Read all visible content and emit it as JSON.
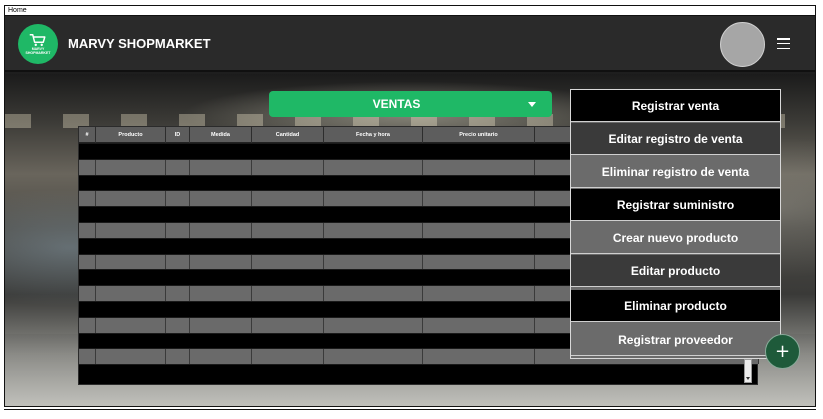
{
  "window": {
    "tab_label": "Home"
  },
  "header": {
    "logo": {
      "icon": "shopping-cart-icon",
      "text_line1": "MARVY",
      "text_line2": "SHOPMARKET"
    },
    "brand": "MARVY SHOPMARKET",
    "avatar": "user-avatar",
    "menu_icon": "hamburger-menu-icon"
  },
  "main": {
    "dropdown": {
      "label": "VENTAS",
      "icon": "chevron-down-icon"
    },
    "table": {
      "columns": [
        "#",
        "Producto",
        "ID",
        "Medida",
        "Cantidad",
        "Fecha y hora",
        "Precio unitario",
        ""
      ],
      "row_count": 15
    },
    "actions": [
      {
        "label": "Registrar venta"
      },
      {
        "label": "Editar registro de venta"
      },
      {
        "label": "Eliminar registro de venta"
      },
      {
        "label": "Registrar suministro"
      },
      {
        "label": "Crear nuevo producto"
      },
      {
        "label": "Editar producto"
      },
      {
        "label": "Eliminar producto"
      },
      {
        "label": "Registrar proveedor"
      }
    ],
    "fab": {
      "symbol": "+",
      "icon": "plus-icon"
    }
  },
  "colors": {
    "accent": "#1fb866",
    "navbar": "#2a2a2a",
    "fab": "#1e5a3a"
  }
}
